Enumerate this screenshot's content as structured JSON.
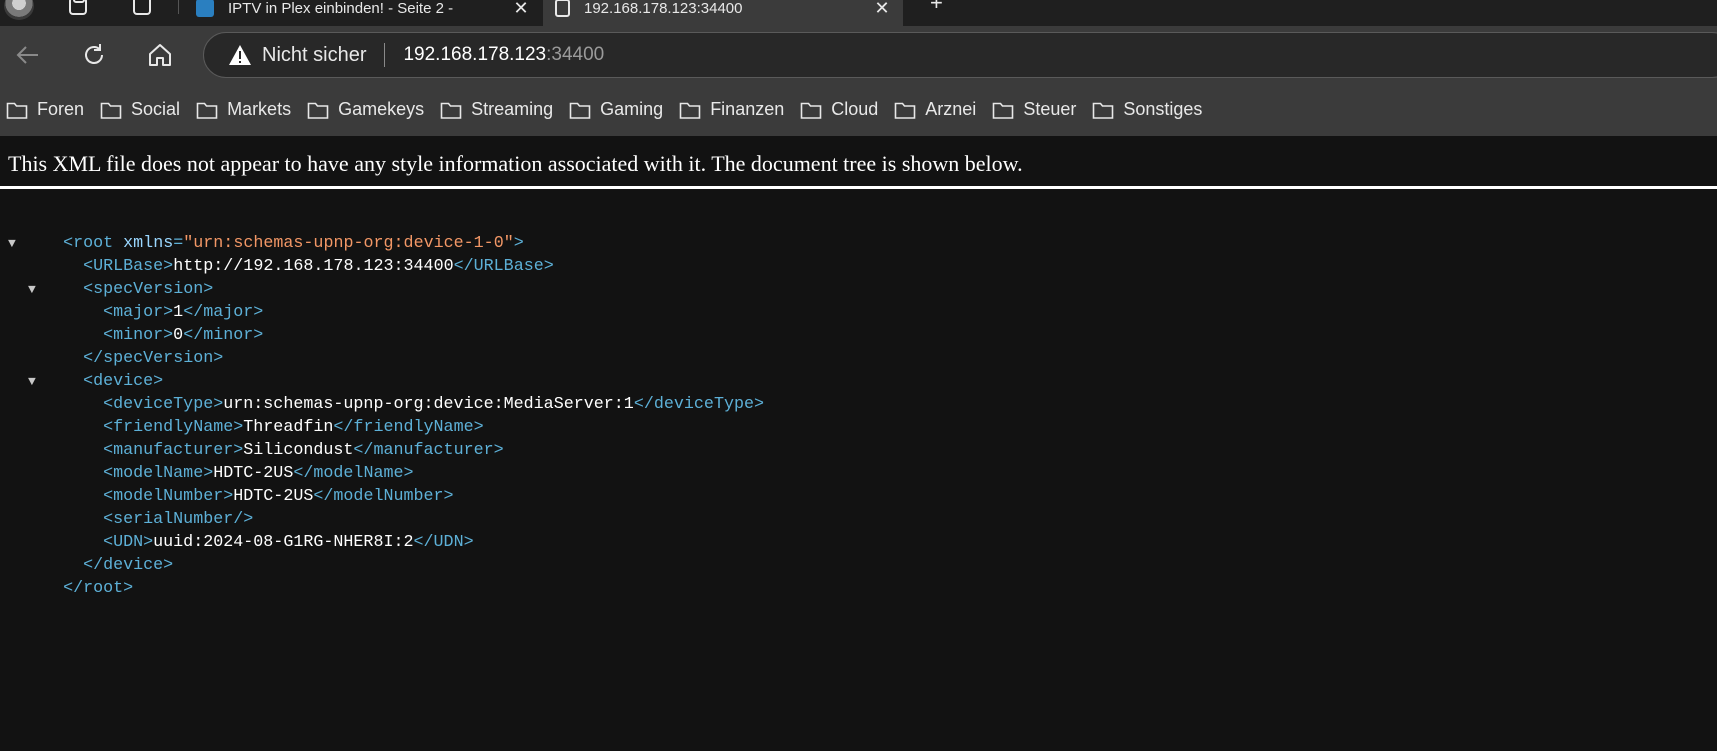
{
  "tabs": [
    {
      "title": "IPTV in Plex einbinden! - Seite 2 -",
      "close": "✕"
    },
    {
      "title": "192.168.178.123:34400",
      "close": "✕"
    }
  ],
  "new_tab": "+",
  "toolbar": {
    "security_label": "Nicht sicher",
    "url_host": "192.168.178.123",
    "url_port": ":34400"
  },
  "bookmarks": [
    "Foren",
    "Social",
    "Markets",
    "Gamekeys",
    "Streaming",
    "Gaming",
    "Finanzen",
    "Cloud",
    "Arznei",
    "Steuer",
    "Sonstiges"
  ],
  "notice": "This XML file does not appear to have any style information associated with it. The document tree is shown below.",
  "xml": {
    "root_open": "<root",
    "xmlns_attr": "xmlns",
    "xmlns_eq": "=",
    "xmlns_val": "\"urn:schemas-upnp-org:device-1-0\"",
    "root_open_end": ">",
    "urlbase_open": "<URLBase>",
    "urlbase_text": "http://192.168.178.123:34400",
    "urlbase_close": "</URLBase>",
    "spec_open": "<specVersion>",
    "major_open": "<major>",
    "major_text": "1",
    "major_close": "</major>",
    "minor_open": "<minor>",
    "minor_text": "0",
    "minor_close": "</minor>",
    "spec_close": "</specVersion>",
    "device_open": "<device>",
    "devicetype_open": "<deviceType>",
    "devicetype_text": "urn:schemas-upnp-org:device:MediaServer:1",
    "devicetype_close": "</deviceType>",
    "friendly_open": "<friendlyName>",
    "friendly_text": "Threadfin",
    "friendly_close": "</friendlyName>",
    "manufacturer_open": "<manufacturer>",
    "manufacturer_text": "Silicondust",
    "manufacturer_close": "</manufacturer>",
    "modelname_open": "<modelName>",
    "modelname_text": "HDTC-2US",
    "modelname_close": "</modelName>",
    "modelnumber_open": "<modelNumber>",
    "modelnumber_text": "HDTC-2US",
    "modelnumber_close": "</modelNumber>",
    "serial_selfclose": "<serialNumber/>",
    "udn_open": "<UDN>",
    "udn_text": "uuid:2024-08-G1RG-NHER8I:2",
    "udn_close": "</UDN>",
    "device_close": "</device>",
    "root_close": "</root>"
  },
  "colors": {
    "tag": "#5db0d7",
    "attribute_value": "#f29766",
    "background": "#121212",
    "toolbar": "#3b3b3b"
  }
}
